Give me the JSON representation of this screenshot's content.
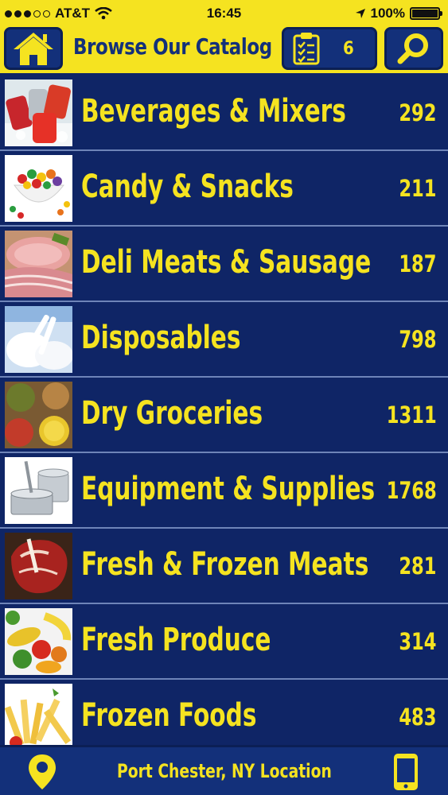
{
  "status": {
    "carrier": "AT&T",
    "time": "16:45",
    "battery": "100%",
    "battery_level": 1.0,
    "signal_filled": 3,
    "signal_total": 5
  },
  "header": {
    "title": "Browse Our Catalog",
    "list_count": "6",
    "home_icon": "home-icon",
    "list_icon": "clipboard-checklist-icon",
    "search_icon": "search-icon"
  },
  "categories": [
    {
      "label": "Beverages & Mixers",
      "count": "292",
      "thumb": "beverage-cans"
    },
    {
      "label": "Candy & Snacks",
      "count": "211",
      "thumb": "candy-bowl"
    },
    {
      "label": "Deli Meats & Sausage",
      "count": "187",
      "thumb": "deli-meats"
    },
    {
      "label": "Disposables",
      "count": "798",
      "thumb": "plastic-cutlery"
    },
    {
      "label": "Dry Groceries",
      "count": "1311",
      "thumb": "dry-goods-cans"
    },
    {
      "label": "Equipment & Supplies",
      "count": "1768",
      "thumb": "cookware"
    },
    {
      "label": "Fresh & Frozen Meats",
      "count": "281",
      "thumb": "steak"
    },
    {
      "label": "Fresh Produce",
      "count": "314",
      "thumb": "vegetables"
    },
    {
      "label": "Frozen Foods",
      "count": "483",
      "thumb": "french-fries"
    }
  ],
  "footer": {
    "location": "Port Chester, NY Location",
    "pin_icon": "map-pin-icon",
    "phone_icon": "phone-icon"
  },
  "colors": {
    "accent_yellow": "#f5e320",
    "navy": "#0f2566",
    "button_blue": "#13307a"
  }
}
